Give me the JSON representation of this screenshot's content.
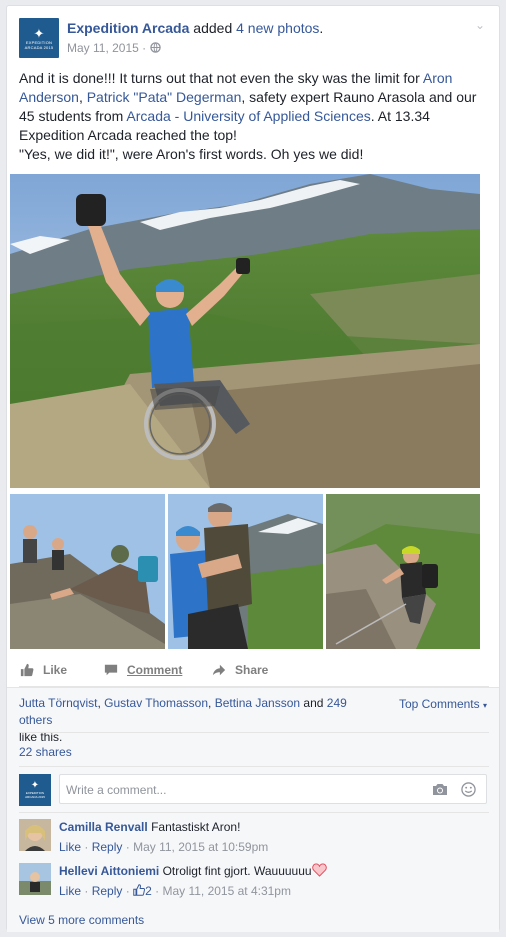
{
  "post": {
    "page_name": "Expedition Arcada",
    "action_prefix": "added",
    "action_link": "4 new photos",
    "action_suffix": ".",
    "date": "May 11, 2015",
    "date_sep": "·",
    "text": {
      "p1_a": "And it is done!!! It turns out that not even the sky was the limit for",
      "link_aron": "Aron Anderson",
      "p1_b": ",",
      "link_pata": "Patrick \"Pata\" Degerman",
      "p1_c": ", safety expert Rauno Arasola and our 45 students from",
      "link_arcada": "Arcada - University of Applied Sciences",
      "p1_d": ". At 13.34 Expedition Arcada reached the top!",
      "p2": "\"Yes, we did it!\", were Aron's first words. Oh yes we did!"
    }
  },
  "actions": {
    "like": "Like",
    "comment": "Comment",
    "share": "Share"
  },
  "social": {
    "liker1": "Jutta Törnqvist",
    "sep1": ",",
    "liker2": "Gustav Thomasson",
    "sep2": ",",
    "liker3": "Bettina Jansson",
    "and": "and",
    "others": "249 others",
    "like_this": "like this.",
    "top_comments": "Top Comments",
    "shares": "22 shares",
    "comment_placeholder": "Write a comment...",
    "more_comments": "View 5 more comments"
  },
  "comments": [
    {
      "author": "Camilla Renvall",
      "text": "Fantastiskt Aron!",
      "like": "Like",
      "sep1": "·",
      "reply": "Reply",
      "sep2": "·",
      "time": "May 11, 2015 at 10:59pm"
    },
    {
      "author": "Hellevi Aittoniemi",
      "text": "Otroligt fint gjort. Wauuuuuu",
      "like": "Like",
      "sep1": "·",
      "reply": "Reply",
      "sep2": "·",
      "likes": "2",
      "sep3": "·",
      "time": "May 11, 2015 at 4:31pm"
    }
  ],
  "colors": {
    "link": "#365899",
    "meta": "#90949c",
    "text": "#1d2129",
    "brand": "#1f5b8f"
  }
}
